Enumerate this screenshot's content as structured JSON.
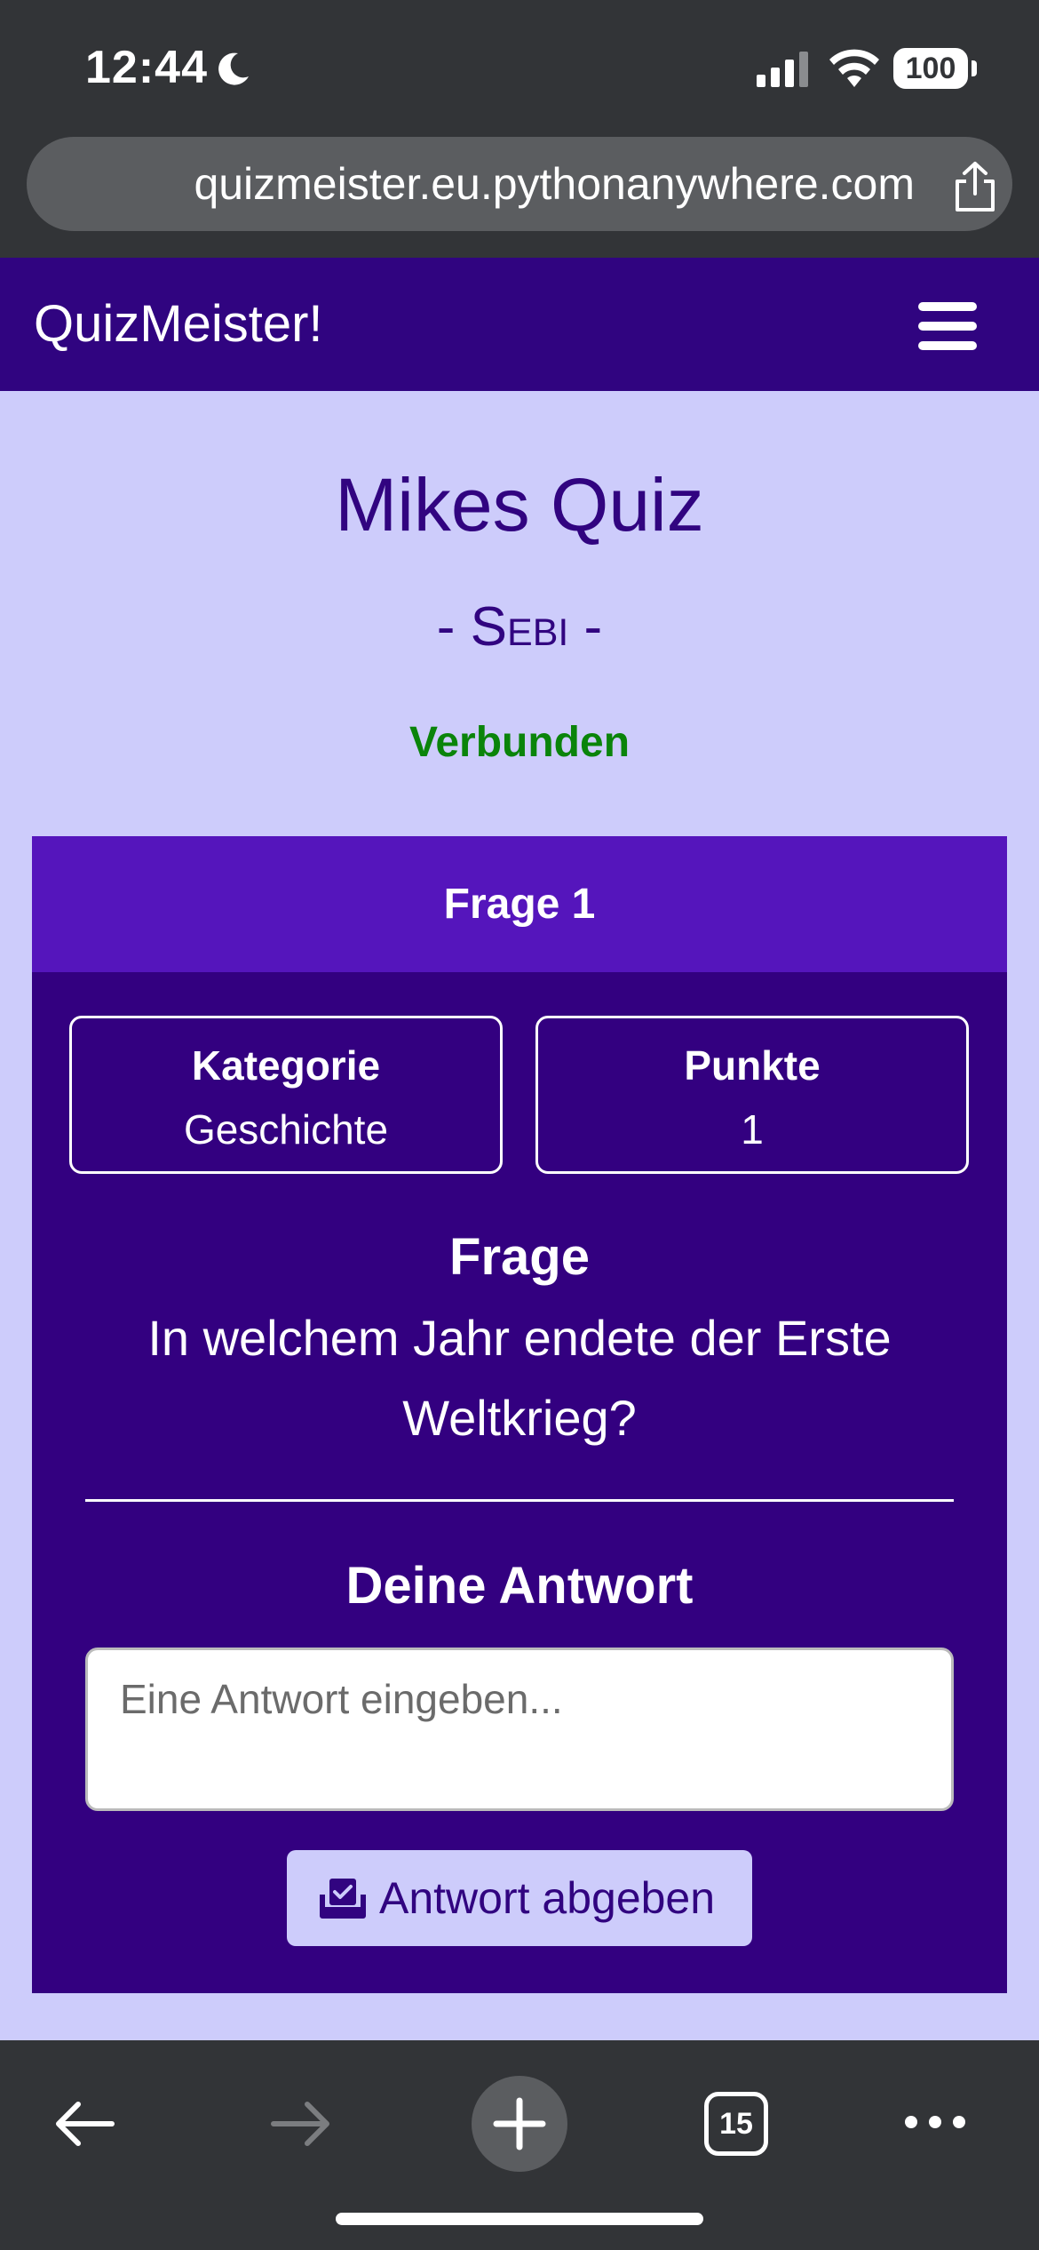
{
  "status_bar": {
    "time": "12:44",
    "battery": "100",
    "icons": [
      "moon-icon",
      "signal-icon",
      "wifi-icon",
      "battery-icon"
    ]
  },
  "browser": {
    "url": "quizmeister.eu.pythonanywhere.com",
    "tab_count": "15"
  },
  "navbar": {
    "brand": "QuizMeister!"
  },
  "header": {
    "quiz_title": "Mikes Quiz",
    "player_name": "- Sebi -",
    "connection_status": "Verbunden"
  },
  "card": {
    "title": "Frage 1",
    "category_label": "Kategorie",
    "category_value": "Geschichte",
    "points_label": "Punkte",
    "points_value": "1",
    "question_label": "Frage",
    "question_text": "In welchem Jahr endete der Erste Weltkrieg?",
    "answer_label": "Deine Antwort",
    "answer_placeholder": "Eine Antwort eingeben...",
    "answer_value": "",
    "submit_label": "Antwort abgeben"
  },
  "colors": {
    "navbar": "#300480",
    "card": "#330080",
    "card_header": "#5515bc",
    "page_bg": "#cdccfb",
    "status_ok": "#0a840a"
  }
}
